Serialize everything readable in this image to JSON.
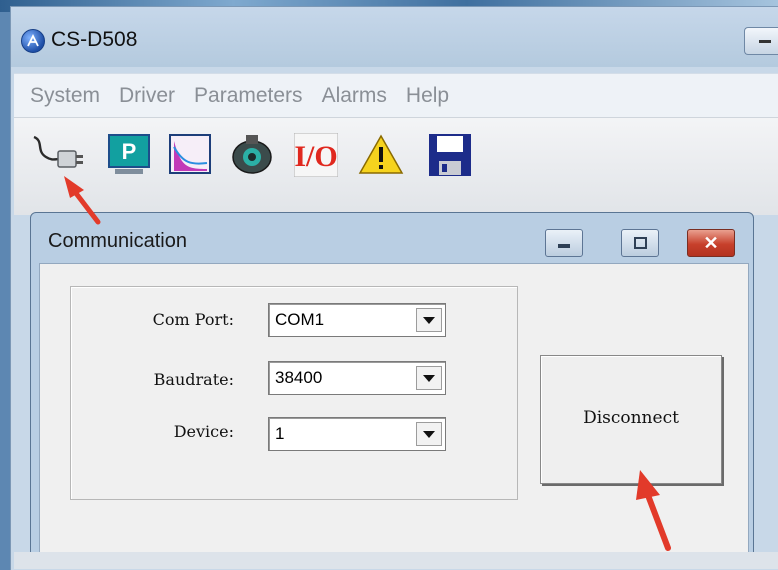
{
  "window": {
    "title": "CS-D508"
  },
  "menu": {
    "items": [
      "System",
      "Driver",
      "Parameters",
      "Alarms",
      "Help"
    ]
  },
  "toolbar": {
    "icons": [
      "connect-plug-icon",
      "parameter-p-icon",
      "chart-icon",
      "motor-icon",
      "io-icon",
      "warning-icon",
      "save-disk-icon"
    ],
    "io_label": "I/O",
    "param_label": "P"
  },
  "dialog": {
    "title": "Communication",
    "fields": {
      "com_port": {
        "label": "Com Port:",
        "value": "COM1"
      },
      "baudrate": {
        "label": "Baudrate:",
        "value": "38400"
      },
      "device": {
        "label": "Device:",
        "value": "1"
      }
    },
    "disconnect_label": "Disconnect"
  },
  "colors": {
    "annotation_arrow": "#e23a2a",
    "close_button": "#c7402b",
    "title_bar": "#b9cee3"
  }
}
